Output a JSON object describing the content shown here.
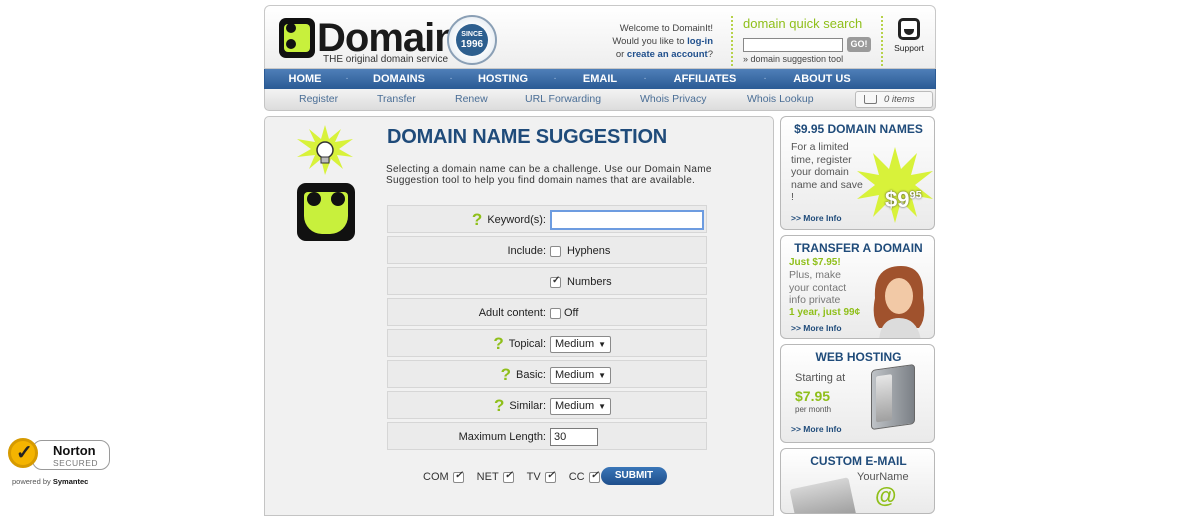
{
  "header": {
    "logo_text": "DomainIt",
    "logo_tm": "TM",
    "logo_tagline": "THE original domain service",
    "seal_top": "SINCE",
    "seal_year": "1996",
    "welcome_line1": "Welcome to DomainIt!",
    "welcome_line2_prefix": "Would you like to ",
    "welcome_login": "log-in",
    "welcome_line3_prefix": "or ",
    "welcome_create": "create an account",
    "welcome_line3_suffix": "?",
    "quick_search_title": "domain quick search",
    "quick_search_value": "",
    "quick_search_go": "GO!",
    "quick_search_link": "» domain suggestion tool",
    "support_label": "Support"
  },
  "nav": [
    "HOME",
    "DOMAINS",
    "HOSTING",
    "EMAIL",
    "AFFILIATES",
    "ABOUT US"
  ],
  "nav_separator": "·",
  "subnav": [
    "Register",
    "Transfer",
    "Renew",
    "URL Forwarding",
    "Whois Privacy",
    "Whois Lookup"
  ],
  "cart": {
    "label": "0 items"
  },
  "main": {
    "title": "DOMAIN NAME SUGGESTION",
    "intro": "Selecting a domain name can be a challenge. Use our Domain Name Suggestion tool to help you find domain names that are available.",
    "help_glyph": "?",
    "keyword_label": "Keyword(s):",
    "keyword_value": "",
    "include_label": "Include:",
    "hyphens_label": "Hyphens",
    "numbers_label": "Numbers",
    "adult_label": "Adult content:",
    "adult_option": "Off",
    "topical_label": "Topical:",
    "topical_value": "Medium",
    "basic_label": "Basic:",
    "basic_value": "Medium",
    "similar_label": "Similar:",
    "similar_value": "Medium",
    "maxlen_label": "Maximum Length:",
    "maxlen_value": "30",
    "tlds": [
      "COM",
      "NET",
      "TV",
      "CC"
    ],
    "submit": "SUBMIT"
  },
  "sidebar": {
    "promo1": {
      "title": "$9.95 DOMAIN NAMES",
      "text": "For a limited time, register your domain name and save !",
      "price": "$9",
      "cents": "95",
      "more": ">> More Info"
    },
    "promo2": {
      "title": "TRANSFER A DOMAIN",
      "line1": "Just $7.95!",
      "text": "Plus, make your contact info private",
      "line2": "1 year, just 99¢",
      "more": ">> More Info"
    },
    "promo3": {
      "title": "WEB HOSTING",
      "text": "Starting at",
      "price": "$7.95",
      "per": "per month",
      "more": ">> More Info"
    },
    "promo4": {
      "title": "CUSTOM E-MAIL",
      "text": "YourName",
      "at": "@"
    }
  },
  "norton": {
    "name": "Norton",
    "secured": "SECURED",
    "powered": "powered by ",
    "brand": "Symantec"
  },
  "colors": {
    "brand_blue": "#1f4b7a",
    "nav_blue": "#2a5a94",
    "accent_green": "#8fbf1a"
  }
}
